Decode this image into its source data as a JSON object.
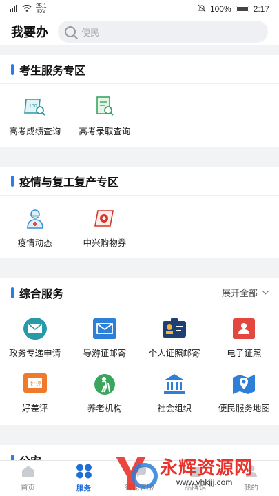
{
  "status": {
    "speed_top": "25.1",
    "speed_bottom": "K/s",
    "battery_pct": "100%",
    "time": "2:17"
  },
  "header": {
    "title": "我要办",
    "search_placeholder": "便民"
  },
  "sections": {
    "exam": {
      "title": "考生服务专区",
      "items": [
        {
          "label": "高考成绩查询",
          "icon": "exam-score-icon"
        },
        {
          "label": "高考录取查询",
          "icon": "admission-query-icon"
        }
      ]
    },
    "epidemic": {
      "title": "疫情与复工复产专区",
      "items": [
        {
          "label": "疫情动态",
          "icon": "doctor-icon"
        },
        {
          "label": "中兴购物券",
          "icon": "shopping-voucher-icon"
        }
      ]
    },
    "general": {
      "title": "综合服务",
      "expand_label": "展开全部",
      "items": [
        {
          "label": "政务专递申请",
          "icon": "express-delivery-icon"
        },
        {
          "label": "导游证邮寄",
          "icon": "envelope-icon"
        },
        {
          "label": "个人证照邮寄",
          "icon": "id-card-icon"
        },
        {
          "label": "电子证照",
          "icon": "e-license-icon"
        },
        {
          "label": "好差评",
          "icon": "rating-icon"
        },
        {
          "label": "养老机构",
          "icon": "elderly-icon"
        },
        {
          "label": "社会组织",
          "icon": "building-icon"
        },
        {
          "label": "便民服务地图",
          "icon": "map-pin-icon"
        }
      ]
    },
    "police": {
      "title": "公安"
    }
  },
  "tabs": [
    {
      "label": "首页",
      "icon": "home-icon"
    },
    {
      "label": "服务",
      "icon": "service-grid-icon",
      "active": true
    },
    {
      "label": "智能客服",
      "icon": "chat-icon"
    },
    {
      "label": "品牌馆",
      "icon": "brand-icon"
    },
    {
      "label": "我的",
      "icon": "user-icon"
    }
  ],
  "watermark": {
    "text": "永辉资源网",
    "url": "www.yhkjjj.com"
  },
  "colors": {
    "accent": "#2a7de1",
    "active_tab": "#1f6fd6"
  }
}
